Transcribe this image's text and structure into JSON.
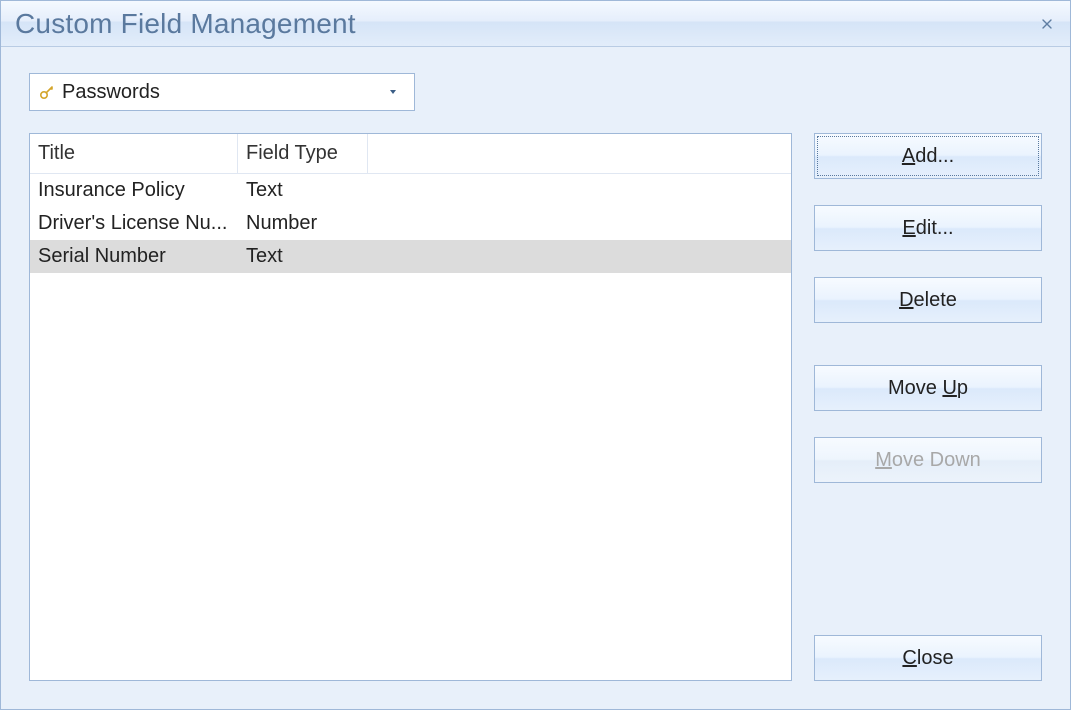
{
  "window": {
    "title": "Custom Field Management"
  },
  "category": {
    "selected": "Passwords"
  },
  "columns": {
    "title": "Title",
    "type": "Field Type"
  },
  "rows": [
    {
      "title": "Insurance Policy",
      "type": "Text",
      "selected": false
    },
    {
      "title": "Driver's License Nu...",
      "type": "Number",
      "selected": false
    },
    {
      "title": "Serial Number",
      "type": "Text",
      "selected": true
    }
  ],
  "buttons": {
    "add": {
      "pre": "",
      "mn": "A",
      "post": "dd..."
    },
    "edit": {
      "pre": "",
      "mn": "E",
      "post": "dit..."
    },
    "delete": {
      "pre": "",
      "mn": "D",
      "post": "elete"
    },
    "moveup": {
      "pre": "Move ",
      "mn": "U",
      "post": "p"
    },
    "movedown": {
      "pre": "",
      "mn": "M",
      "post": "ove Down"
    },
    "close": {
      "pre": "",
      "mn": "C",
      "post": "lose"
    }
  }
}
